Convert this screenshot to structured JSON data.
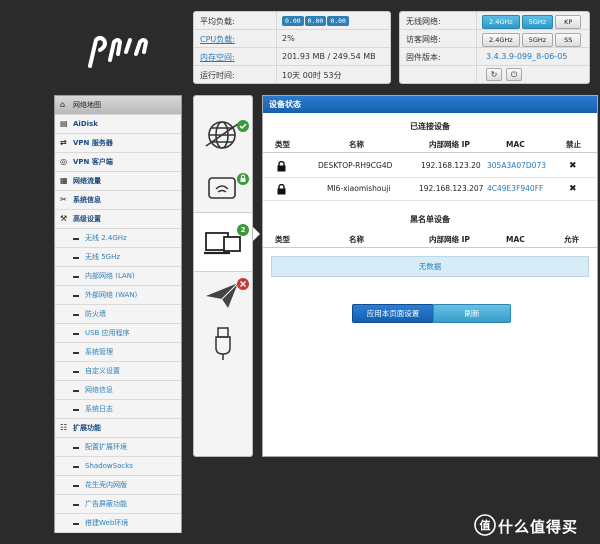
{
  "logo": "pdcn",
  "status": {
    "cpu_load_label": "平均负载:",
    "cpu_load_values": [
      "0.00",
      "0.00",
      "0.00"
    ],
    "cpu_usage_label": "CPU负载:",
    "cpu_usage_value": "2%",
    "memory_label": "内存空间:",
    "memory_value": "201.93 MB / 249.54 MB",
    "uptime_label": "运行时间:",
    "uptime_value": "10天 00时 53分"
  },
  "network": {
    "wireless_label": "无线网络:",
    "wireless_buttons": [
      "2.4GHz",
      "5GHz",
      "KP"
    ],
    "guest_label": "访客网络:",
    "guest_buttons": [
      "2.4GHz",
      "5GHz",
      "SS"
    ],
    "firmware_label": "固件版本:",
    "firmware_value": "3.4.3.9-099_8-06-05"
  },
  "menu": {
    "header": "网络地图",
    "items": [
      {
        "label": "AiDisk",
        "type": "top"
      },
      {
        "label": "VPN 服务器",
        "type": "top"
      },
      {
        "label": "VPN 客户端",
        "type": "top"
      },
      {
        "label": "网络流量",
        "type": "top"
      },
      {
        "label": "系统信息",
        "type": "top"
      },
      {
        "label": "高级设置",
        "type": "top"
      },
      {
        "label": "无线 2.4GHz",
        "type": "sub"
      },
      {
        "label": "无线 5GHz",
        "type": "sub"
      },
      {
        "label": "内部网络 (LAN)",
        "type": "sub"
      },
      {
        "label": "外部网络 (WAN)",
        "type": "sub"
      },
      {
        "label": "防火墙",
        "type": "sub"
      },
      {
        "label": "USB 应用程序",
        "type": "sub"
      },
      {
        "label": "系统管理",
        "type": "sub"
      },
      {
        "label": "自定义设置",
        "type": "sub"
      },
      {
        "label": "网络信息",
        "type": "sub"
      },
      {
        "label": "系统日志",
        "type": "sub"
      },
      {
        "label": "扩展功能",
        "type": "top"
      },
      {
        "label": "配置扩展环境",
        "type": "sub"
      },
      {
        "label": "ShadowSocks",
        "type": "sub"
      },
      {
        "label": "花生壳内网版",
        "type": "sub"
      },
      {
        "label": "广告屏蔽功能",
        "type": "sub"
      },
      {
        "label": "搭建Web环境",
        "type": "sub"
      }
    ]
  },
  "device_icons": {
    "clients_count": "2"
  },
  "main": {
    "title": "设备状态",
    "connected_section": "已连接设备",
    "headers": [
      "类型",
      "名称",
      "内部网络 IP",
      "MAC",
      "禁止"
    ],
    "devices": [
      {
        "name": "DESKTOP-RH9CG4D",
        "ip": "192.168.123.20",
        "mac": "305A3A07D073"
      },
      {
        "name": "MI6-xiaomishouji",
        "ip": "192.168.123.207",
        "mac": "4C49E3F940FF"
      }
    ],
    "blacklist_section": "黑名单设备",
    "blacklist_headers": [
      "类型",
      "名称",
      "内部网络 IP",
      "MAC",
      "允许"
    ],
    "no_data": "无数据",
    "apply_button": "应用本页面设置",
    "refresh_button": "刷新"
  },
  "watermark": "什么值得买"
}
